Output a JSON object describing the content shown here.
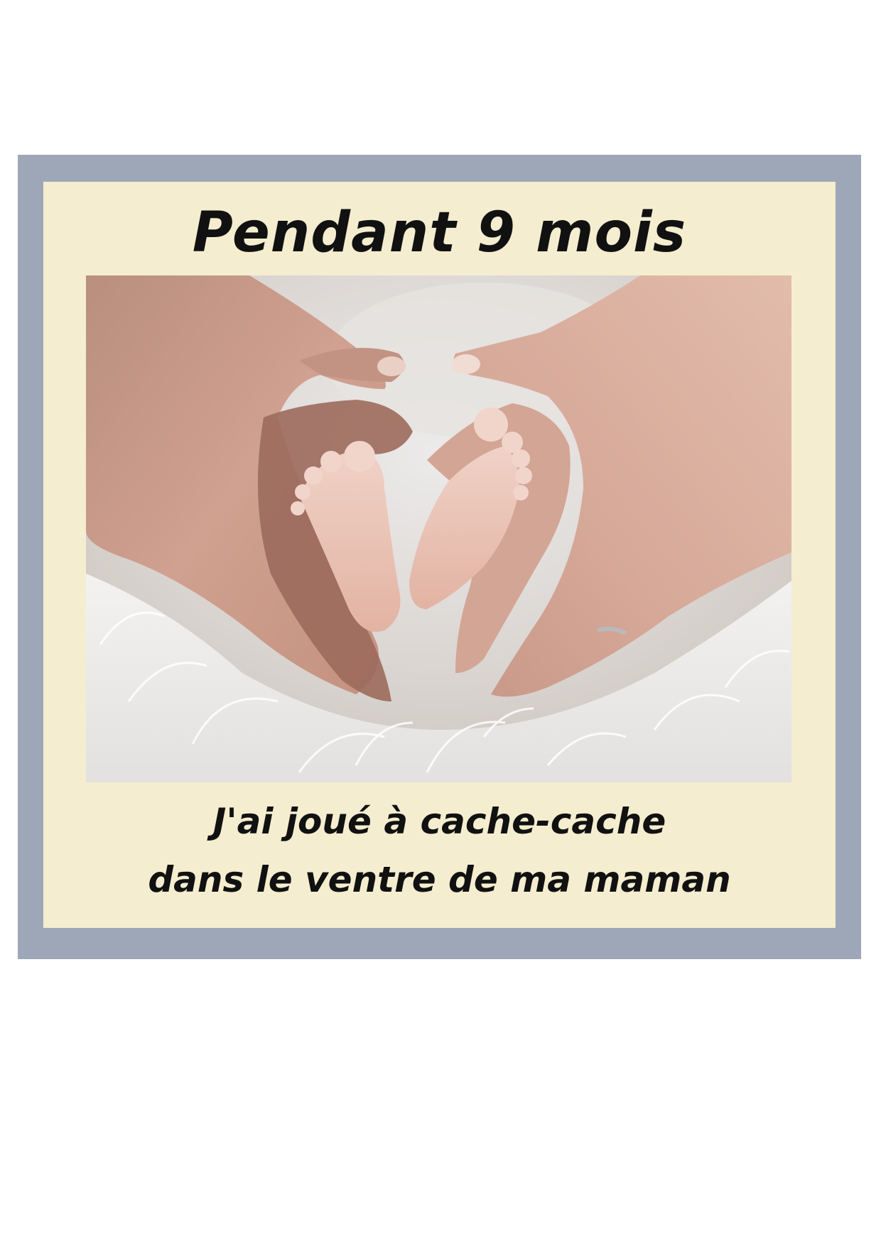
{
  "card": {
    "title": "Pendant 9 mois",
    "caption_line1": "J'ai joué à cache-cache",
    "caption_line2": "dans le ventre de ma maman",
    "colors": {
      "frame": "#9ea7b8",
      "panel": "#f4edcf",
      "text": "#111111"
    },
    "photo_icon": "baby-feet-in-heart-hands-photo"
  }
}
